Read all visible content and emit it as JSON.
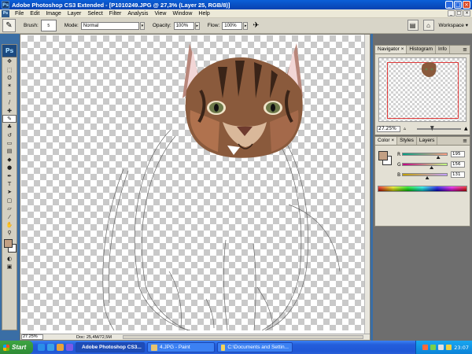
{
  "window": {
    "title": "Adobe Photoshop CS3 Extended - [P1010249.JPG @ 27,3% (Layer 25, RGB/8)]",
    "app_badge": "Ps",
    "min_glyph": "_",
    "max_glyph": "□",
    "close_glyph": "×"
  },
  "menu": {
    "items": [
      "File",
      "Edit",
      "Image",
      "Layer",
      "Select",
      "Filter",
      "Analysis",
      "View",
      "Window",
      "Help"
    ]
  },
  "options": {
    "brush_label": "Brush:",
    "brush_size": "5",
    "mode_label": "Mode:",
    "mode_value": "Normal",
    "opacity_label": "Opacity:",
    "opacity_value": "100%",
    "flow_label": "Flow:",
    "flow_value": "100%",
    "workspace_label": "Workspace ▾"
  },
  "toolbox": {
    "badge": "Ps",
    "tools": [
      {
        "name": "move-tool",
        "glyph": "✥"
      },
      {
        "name": "marquee-tool",
        "glyph": "⬚"
      },
      {
        "name": "lasso-tool",
        "glyph": "ʘ"
      },
      {
        "name": "magic-wand-tool",
        "glyph": "✶"
      },
      {
        "name": "crop-tool",
        "glyph": "⌗"
      },
      {
        "name": "slice-tool",
        "glyph": "∕"
      },
      {
        "name": "healing-tool",
        "glyph": "✚"
      },
      {
        "name": "brush-tool",
        "glyph": "✎"
      },
      {
        "name": "clone-stamp-tool",
        "glyph": "♣"
      },
      {
        "name": "history-brush-tool",
        "glyph": "↺"
      },
      {
        "name": "eraser-tool",
        "glyph": "▭"
      },
      {
        "name": "gradient-tool",
        "glyph": "▤"
      },
      {
        "name": "blur-tool",
        "glyph": "◆"
      },
      {
        "name": "dodge-tool",
        "glyph": "●"
      },
      {
        "name": "pen-tool",
        "glyph": "✒"
      },
      {
        "name": "type-tool",
        "glyph": "T"
      },
      {
        "name": "path-selection-tool",
        "glyph": "➤"
      },
      {
        "name": "shape-tool",
        "glyph": "▢"
      },
      {
        "name": "notes-tool",
        "glyph": "▱"
      },
      {
        "name": "eyedropper-tool",
        "glyph": "⁄"
      },
      {
        "name": "hand-tool",
        "glyph": "✋"
      },
      {
        "name": "zoom-tool",
        "glyph": "⚲"
      }
    ],
    "foreground_color": "#c3a083",
    "background_color": "#ffffff"
  },
  "document": {
    "zoom": "27.25%",
    "doc_size": "Doc: 25,4M/72,5M"
  },
  "navigator": {
    "tabs": [
      "Navigator ×",
      "Histogram",
      "Info"
    ],
    "zoom": "27.25%",
    "slider_fraction": 0.3
  },
  "color_panel": {
    "tabs": [
      "Color ×",
      "Styles",
      "Layers"
    ],
    "fg": "#c3a083",
    "channels": [
      {
        "label": "R",
        "value": "195",
        "fraction": 0.76,
        "grad": "linear-gradient(90deg,#00a083,#ffa083)"
      },
      {
        "label": "G",
        "value": "156",
        "fraction": 0.61,
        "grad": "linear-gradient(90deg,#c30083,#c3ff83)"
      },
      {
        "label": "B",
        "value": "131",
        "fraction": 0.51,
        "grad": "linear-gradient(90deg,#c3a000,#c3a0ff)"
      }
    ]
  },
  "taskbar": {
    "start": "Start",
    "tasks": [
      {
        "label": "Adobe Photoshop CS3...",
        "color": "#1c4a80",
        "active": true
      },
      {
        "label": "4.JPG - Paint",
        "color": "#e8c470",
        "active": false
      },
      {
        "label": "C:\\Documents and Settin...",
        "color": "#f3d25a",
        "active": false
      }
    ],
    "clock": "23:07"
  }
}
